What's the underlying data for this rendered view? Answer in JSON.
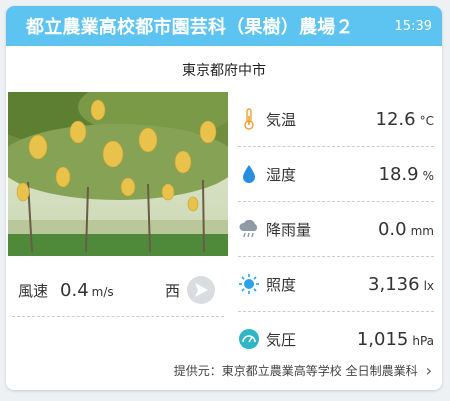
{
  "header": {
    "title": "都立農業高校都市園芸科（果樹）農場２",
    "time": "15:39"
  },
  "location": "東京都府中市",
  "photo": {
    "alt": "果樹園の写真",
    "icon": "orchard-photo"
  },
  "wind": {
    "label": "風速",
    "value": "0.4",
    "unit": "m/s",
    "direction": "西",
    "icon": "wind-direction-arrow-icon"
  },
  "metrics": [
    {
      "key": "temperature",
      "label": "気温",
      "value": "12.6",
      "unit": "°C",
      "icon": "thermometer-icon",
      "color": "#f0a030"
    },
    {
      "key": "humidity",
      "label": "湿度",
      "value": "18.9",
      "unit": "%",
      "icon": "droplet-icon",
      "color": "#2a8ee0"
    },
    {
      "key": "rainfall",
      "label": "降雨量",
      "value": "0.0",
      "unit": "mm",
      "icon": "rain-cloud-icon",
      "color": "#8f9aa6"
    },
    {
      "key": "illuminance",
      "label": "照度",
      "value": "3,136",
      "unit": "lx",
      "icon": "sun-icon",
      "color": "#2aa4e8"
    },
    {
      "key": "pressure",
      "label": "気圧",
      "value": "1,015",
      "unit": "hPa",
      "icon": "gauge-icon",
      "color": "#2fb6c6"
    }
  ],
  "footer": {
    "text": "提供元：東京都立農業高等学校 全日制農業科",
    "chevron": "›"
  },
  "colors": {
    "header": "#5dc3f1",
    "background": "#eef1f4"
  }
}
